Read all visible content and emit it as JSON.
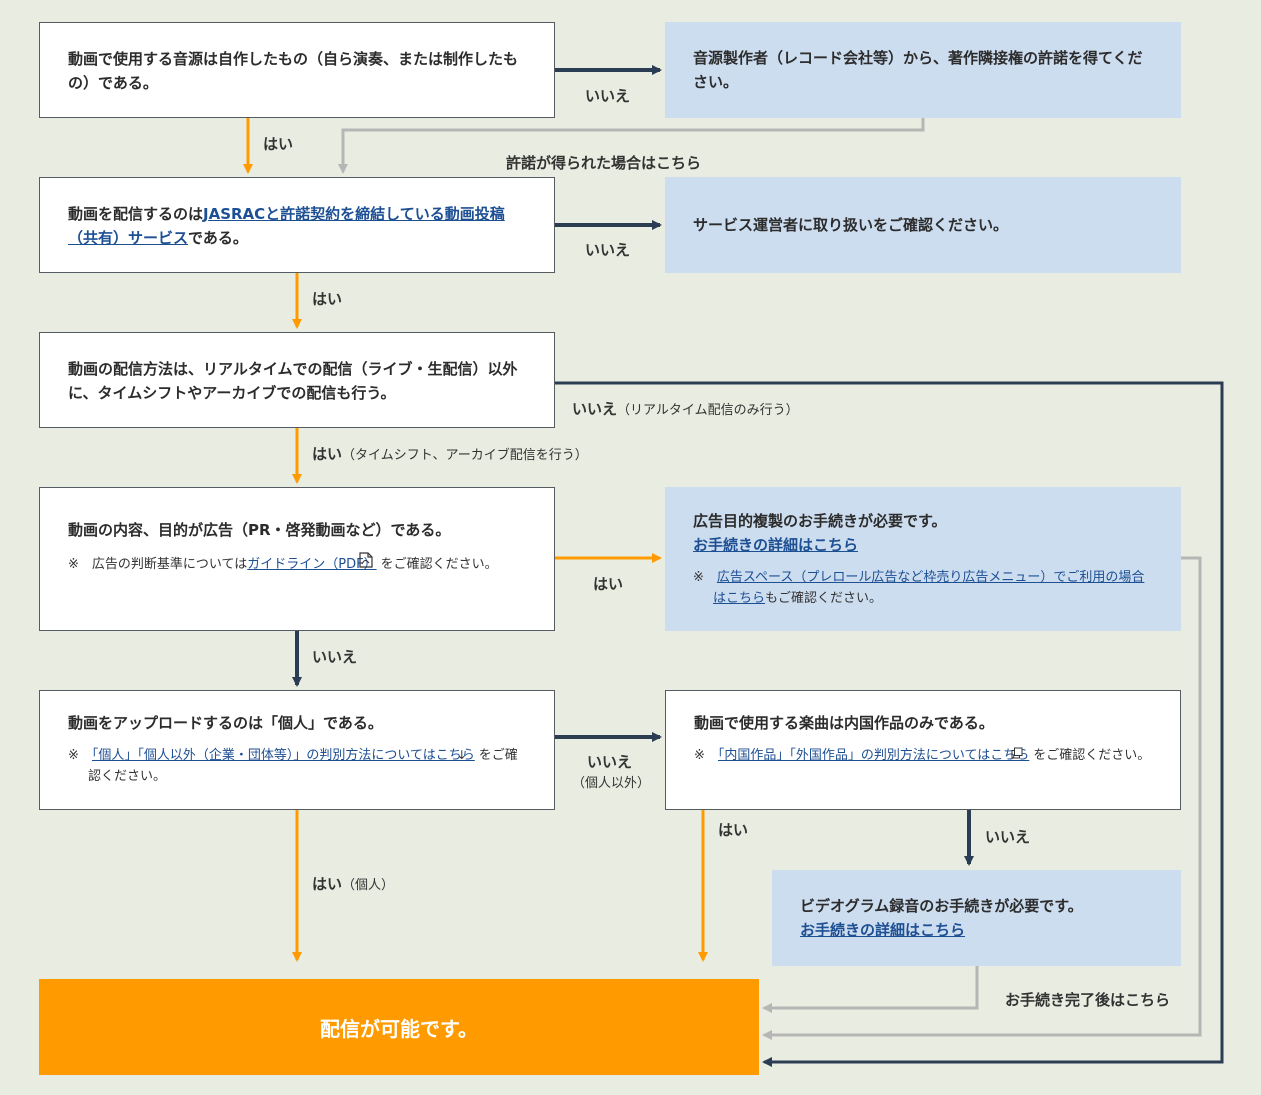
{
  "boxes": {
    "q1": "動画で使用する音源は自作したもの（自ら演奏、または制作したもの）である。",
    "a_permission": "音源製作者（レコード会社等）から、著作隣接権の許諾を得てください。",
    "q2": {
      "pre": "動画を配信するのは",
      "link": "JASRACと許諾契約を締結している動画投稿（共有）サービス",
      "post": "である。"
    },
    "a_service": "サービス運営者に取り扱いをご確認ください。",
    "q3": "動画の配信方法は、リアルタイムでの配信（ライブ・生配信）以外に、タイムシフトやアーカイブでの配信も行う。",
    "q4": {
      "main": "動画の内容、目的が広告（PR・啓発動画など）である。",
      "note_mark": "※",
      "note_pre": "広告の判断基準については",
      "note_link": "ガイドライン（PDF）",
      "note_post": "をご確認ください。"
    },
    "a_ad": {
      "main": "広告目的複製のお手続きが必要です。",
      "link": "お手続きの詳細はこちら",
      "note_mark": "※",
      "note_link": "広告スペース（プレロール広告など枠売り広告メニュー）でご利用の場合はこちら",
      "note_post": "もご確認ください。"
    },
    "q5": {
      "main": "動画をアップロードするのは「個人」である。",
      "note_mark": "※",
      "note_link": "「個人」「個人以外（企業・団体等）」の判別方法についてはこちら",
      "note_post": "をご確認ください。"
    },
    "q6": {
      "main": "動画で使用する楽曲は内国作品のみである。",
      "note_mark": "※",
      "note_link": "「内国作品」「外国作品」の判別方法についてはこちら",
      "note_post": "をご確認ください。"
    },
    "a_video": {
      "main": "ビデオグラム録音のお手続きが必要です。",
      "link": "お手続きの詳細はこちら"
    },
    "final": "配信が可能です。"
  },
  "labels": {
    "yes": "はい",
    "no": "いいえ",
    "q3_no_sub": "（リアルタイム配信のみ行う）",
    "q3_yes_sub": "（タイムシフト、アーカイブ配信を行う）",
    "q5_no_sub": "（個人以外）",
    "q5_yes_sub": "（個人）",
    "after_permission": "許諾が得られた場合はこちら",
    "after_procedure": "お手続き完了後はこちら"
  },
  "icons": {
    "pdf": "pdf-file-icon",
    "down": "arrow-down-icon",
    "external": "external-window-icon"
  },
  "colors": {
    "background": "#e9ece0",
    "question_box": "#ffffff",
    "answer_box": "#cdddf0",
    "yes_arrow": "#ff9b00",
    "no_arrow": "#2b3d52",
    "return_arrow": "#b6b6b6",
    "final_box": "#ff9b00",
    "link": "#1d4f93"
  }
}
